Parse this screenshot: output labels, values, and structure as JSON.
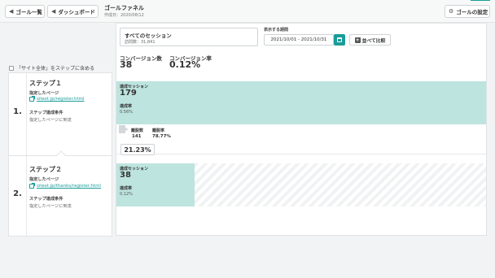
{
  "topbar": {
    "goal_list_label": "ゴール一覧",
    "dashboard_label": "ダッシュボード",
    "title": "ゴールファネル",
    "created": "作成日：2020/08/12",
    "settings_label": "ゴールの設定"
  },
  "scope": {
    "label": "「サイト全体」をステップに含める"
  },
  "session_selector": {
    "title": "すべてのセッション",
    "subtitle": "訪問数：31,841"
  },
  "period": {
    "label": "表示する期間",
    "value": "2021/10/01 - 2021/10/31"
  },
  "compare": {
    "label": "並べて比較"
  },
  "kpi": {
    "cv_label": "コンバージョン数",
    "cv_value": "38",
    "cvr_label": "コンバージョン率",
    "cvr_value": "0.12%"
  },
  "steps": [
    {
      "number": "1.",
      "title": "ステップ１",
      "page_label": "指定したページ",
      "page_url": "sitest.jp/register.html",
      "cond_label": "ステップ達成条件",
      "cond_value": "指定したページに到達",
      "sessions_label": "達成セッション",
      "sessions": "179",
      "rate_label": "達成率",
      "rate": "0.56%"
    },
    {
      "number": "2.",
      "title": "ステップ２",
      "page_label": "指定したページ",
      "page_url": "sitest.jp/thanks/register.html",
      "cond_label": "ステップ達成条件",
      "cond_value": "指定したページに到達",
      "sessions_label": "達成セッション",
      "sessions": "38",
      "rate_label": "達成率",
      "rate": "0.12%"
    }
  ],
  "dropoff": {
    "count_label": "離脱数",
    "count": "141",
    "rate_label": "離脱率",
    "rate": "78.77%",
    "continue_rate": "21.23%"
  },
  "chart_data": {
    "type": "bar",
    "categories": [
      "ステップ１",
      "ステップ２"
    ],
    "series": [
      {
        "values": [
          179,
          38
        ]
      }
    ]
  },
  "colors": {
    "accent": "#1a9c9a",
    "bar_fill": "#bde4df",
    "hatch": "#f1f2f3"
  }
}
